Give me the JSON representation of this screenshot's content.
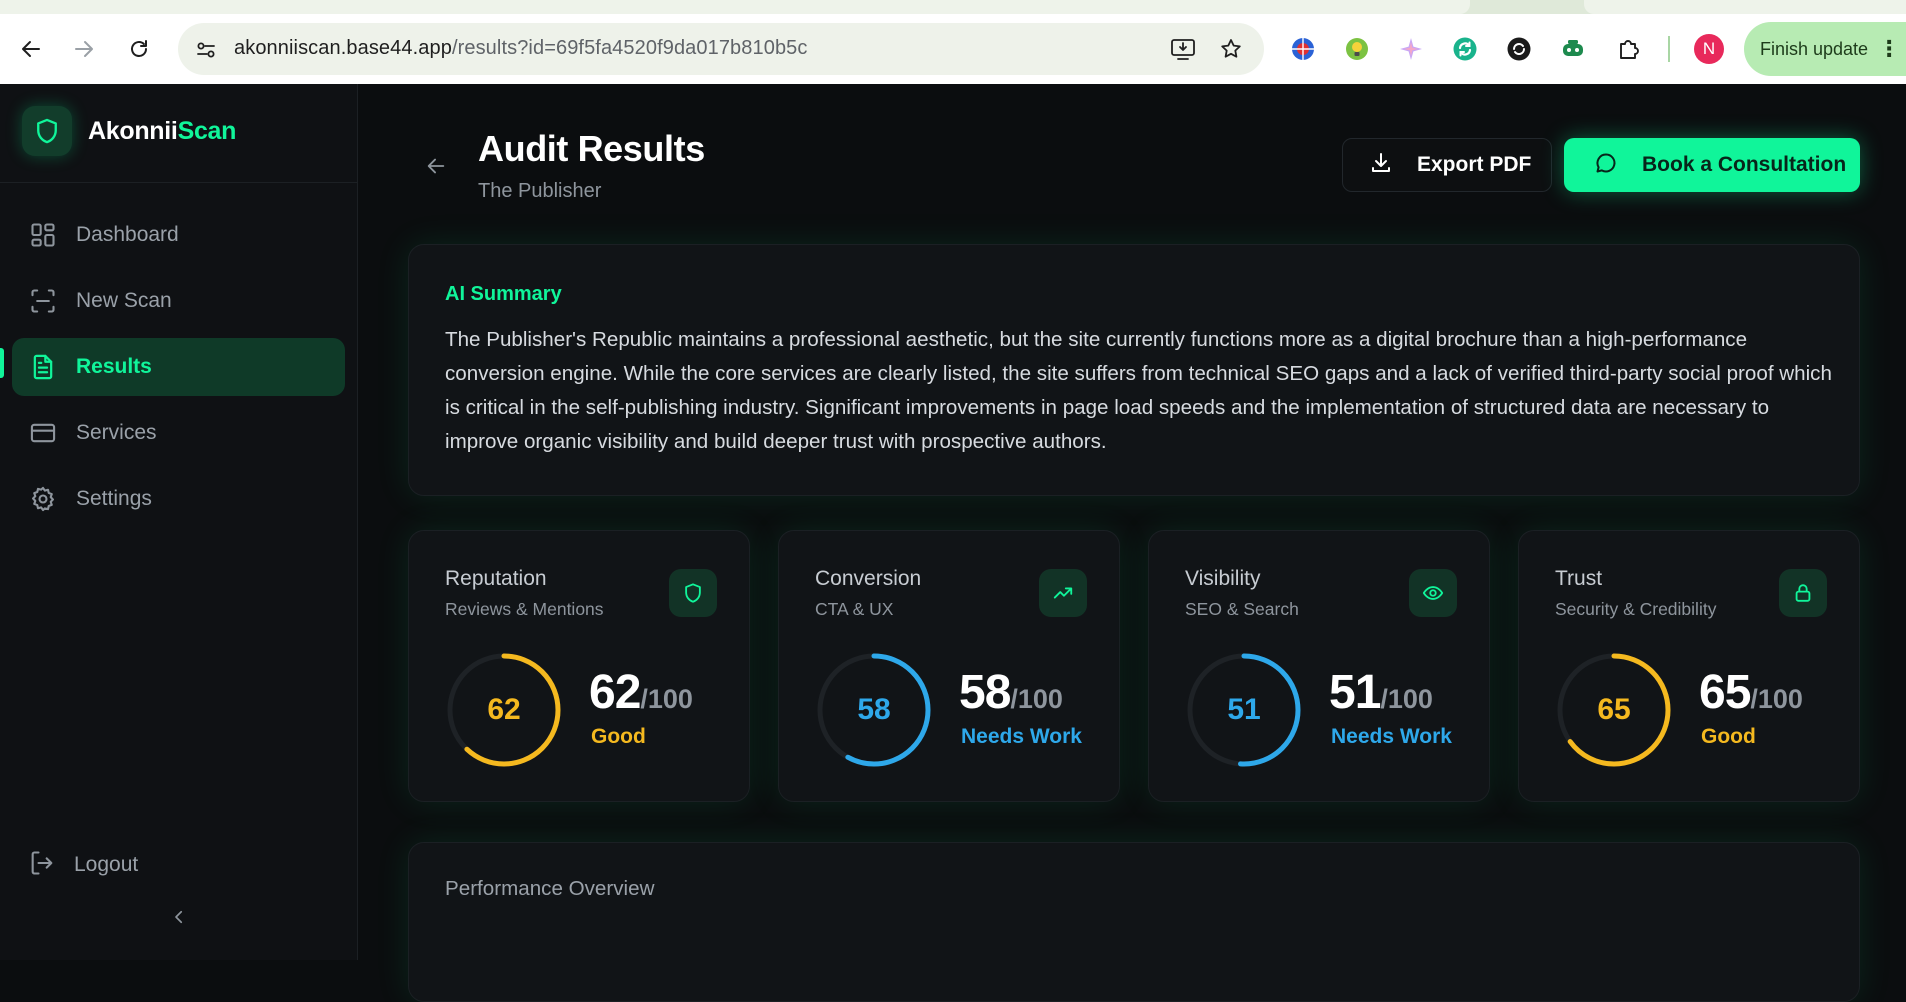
{
  "browser": {
    "url_host": "akonniiscan.base44.app",
    "url_path": "/results?id=69f5fa4520f9da017b810b5c",
    "profile_initial": "N",
    "finish_update_label": "Finish update"
  },
  "brand": {
    "name_primary": "Akonnii",
    "name_accent": "Scan"
  },
  "sidebar": {
    "items": [
      {
        "label": "Dashboard",
        "icon": "dashboard-icon"
      },
      {
        "label": "New Scan",
        "icon": "scan-icon"
      },
      {
        "label": "Results",
        "icon": "document-icon"
      },
      {
        "label": "Services",
        "icon": "card-icon"
      },
      {
        "label": "Settings",
        "icon": "gear-icon"
      }
    ],
    "active_index": 2,
    "logout_label": "Logout"
  },
  "header": {
    "title": "Audit Results",
    "subtitle": "The Publisher",
    "export_label": "Export PDF",
    "consult_label": "Book a Consultation"
  },
  "summary": {
    "heading": "AI Summary",
    "text": "The Publisher's Republic maintains a professional aesthetic, but the site currently functions more as a digital brochure than a high-performance conversion engine. While the core services are clearly listed, the site suffers from technical SEO gaps and a lack of verified third-party social proof which is critical in the self-publishing industry. Significant improvements in page load speeds and the implementation of structured data are necessary to improve organic visibility and build deeper trust with prospective authors."
  },
  "scores": [
    {
      "category": "Reputation",
      "subtitle": "Reviews & Mentions",
      "score": 62,
      "out_of": "/100",
      "rating": "Good",
      "color": "#f5b91f",
      "icon": "shield-icon"
    },
    {
      "category": "Conversion",
      "subtitle": "CTA & UX",
      "score": 58,
      "out_of": "/100",
      "rating": "Needs Work",
      "color": "#2ea8ea",
      "icon": "trending-up-icon"
    },
    {
      "category": "Visibility",
      "subtitle": "SEO & Search",
      "score": 51,
      "out_of": "/100",
      "rating": "Needs Work",
      "color": "#2ea8ea",
      "icon": "eye-icon"
    },
    {
      "category": "Trust",
      "subtitle": "Security & Credibility",
      "score": 65,
      "out_of": "/100",
      "rating": "Good",
      "color": "#f5b91f",
      "icon": "lock-icon"
    }
  ],
  "performance": {
    "title": "Performance Overview"
  },
  "colors": {
    "accent": "#10f59a",
    "good": "#f5b91f",
    "needs_work": "#2ea8ea"
  }
}
